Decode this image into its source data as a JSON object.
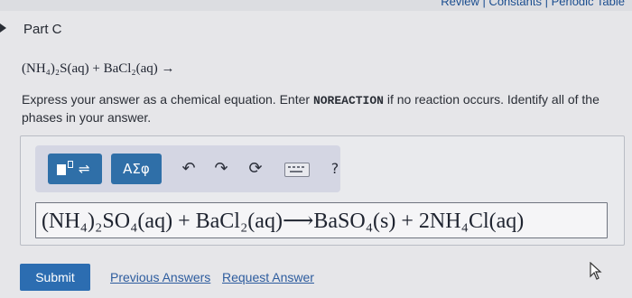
{
  "header": {
    "links": "Review | Constants | Periodic Table"
  },
  "part": {
    "title": "Part C"
  },
  "reaction": {
    "text": "(NH₄)₂S(aq) + BaCl₂(aq) →"
  },
  "instructions": {
    "part1": "Express your answer as a chemical equation. Enter ",
    "keyword": "NOREACTION",
    "part2": " if no reaction occurs. Identify all of the phases in your answer."
  },
  "toolbar": {
    "templates_icon": "templates-icon",
    "greek_label": "ΑΣφ",
    "undo_icon": "↶",
    "redo_icon": "↷",
    "reset_icon": "⟳",
    "keyboard_icon": "keyboard-icon",
    "help_label": "?"
  },
  "answer": {
    "equation": "(NH₄)₂SO₄(aq) + BaCl₂(aq)⟶BaSO₄(s) + 2NH₄Cl(aq)"
  },
  "actions": {
    "submit_label": "Submit",
    "previous_answers_label": "Previous Answers",
    "request_answer_label": "Request Answer"
  },
  "colors": {
    "accent": "#2c6db1",
    "link": "#2d5c9e",
    "toolbar_bg": "#d4d6e3"
  }
}
